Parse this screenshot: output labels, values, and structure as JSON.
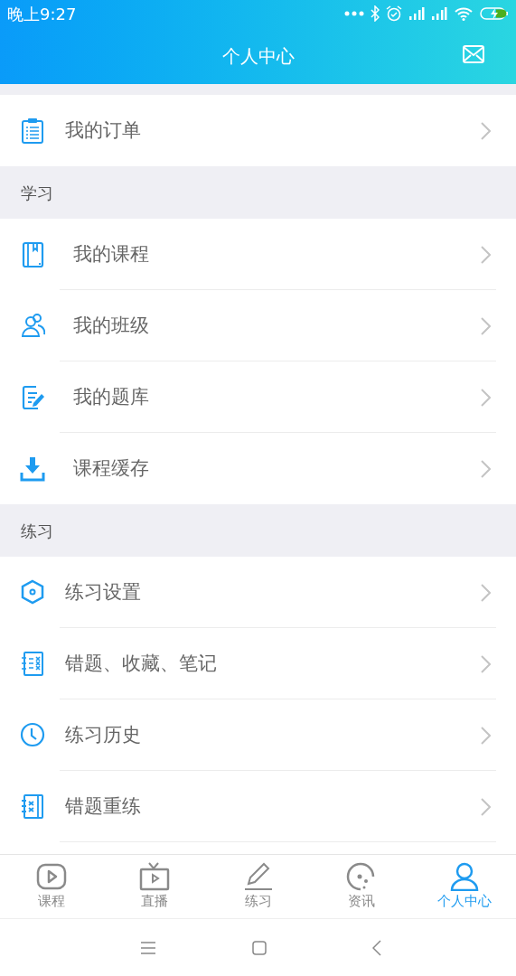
{
  "status_bar": {
    "time": "晚上9:27"
  },
  "header": {
    "title": "个人中心"
  },
  "groups": [
    {
      "items": [
        {
          "label": "我的订单"
        }
      ]
    },
    {
      "title": "学习",
      "items": [
        {
          "label": "我的课程"
        },
        {
          "label": "我的班级"
        },
        {
          "label": "我的题库"
        },
        {
          "label": "课程缓存"
        }
      ]
    },
    {
      "title": "练习",
      "items": [
        {
          "label": "练习设置"
        },
        {
          "label": "错题、收藏、笔记"
        },
        {
          "label": "练习历史"
        },
        {
          "label": "错题重练"
        }
      ]
    }
  ],
  "tabs": [
    {
      "label": "课程",
      "selected": false
    },
    {
      "label": "直播",
      "selected": false
    },
    {
      "label": "练习",
      "selected": false
    },
    {
      "label": "资讯",
      "selected": false
    },
    {
      "label": "个人中心",
      "selected": true
    }
  ]
}
